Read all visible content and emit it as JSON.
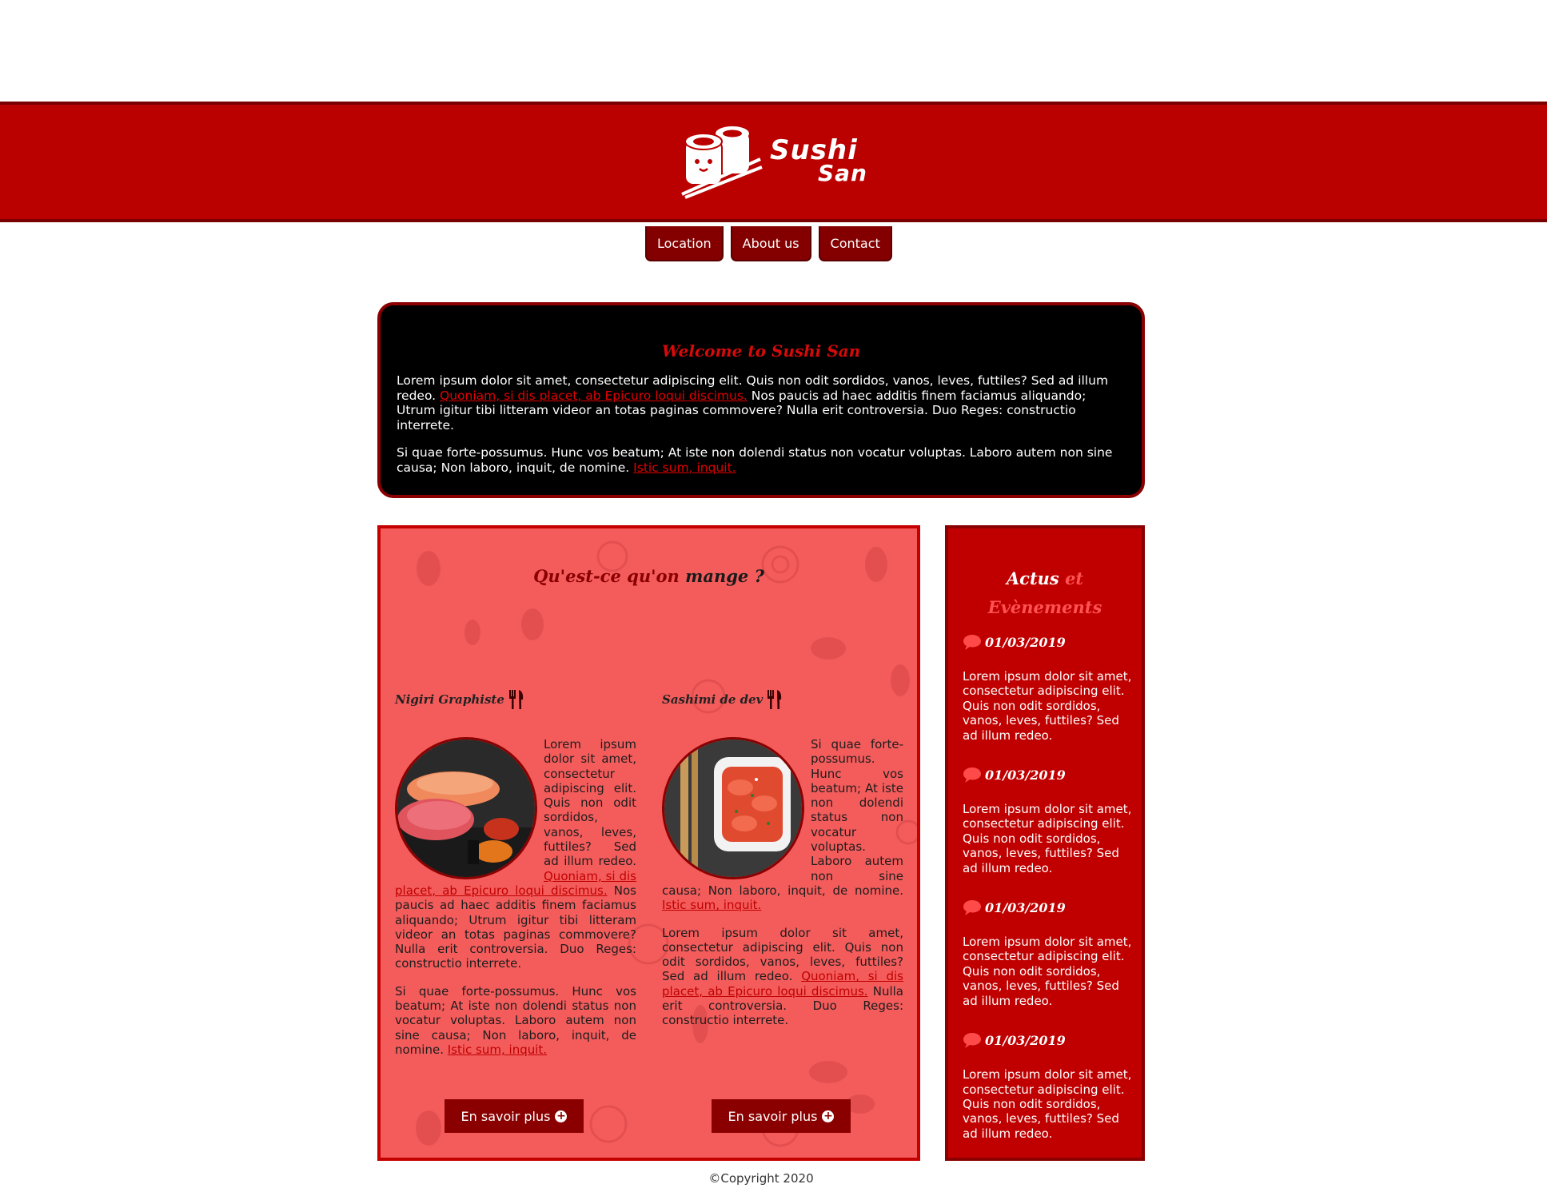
{
  "brand": {
    "line1": "Sushi",
    "line2": "San"
  },
  "nav": {
    "items": [
      "Location",
      "About us",
      "Contact"
    ]
  },
  "welcome": {
    "title": "Welcome to Sushi San",
    "p1_text1": "Lorem ipsum dolor sit amet, consectetur adipiscing elit. Quis non odit sordidos, vanos, leves, futtiles? Sed ad illum redeo.",
    "p1_link": "Quoniam, si dis placet, ab Epicuro loqui discimus.",
    "p1_text2": " Nos paucis ad haec additis finem faciamus aliquando; Utrum igitur tibi litteram videor an totas paginas commovere? Nulla erit controversia. Duo Reges: constructio interrete.",
    "p2_text": "Si quae forte-possumus. Hunc vos beatum; At iste non dolendi status non vocatur voluptas. Laboro autem non sine causa; Non laboro, inquit, de nomine.",
    "p2_link": "Istic sum, inquit."
  },
  "menu": {
    "title_part1": "Qu'est-ce qu'on",
    "title_part2": "mange ?",
    "items": [
      {
        "name": "Nigiri Graphiste",
        "p1_text": "Lorem ipsum dolor sit amet, consectetur adipiscing elit. Quis non odit sordidos, vanos, leves, futtiles? Sed ad illum redeo.",
        "p1_link": "Quoniam, si dis placet, ab Epicuro loqui discimus.",
        "p1_text2": " Nos paucis ad haec additis finem faciamus aliquando; Utrum igitur tibi litteram videor an totas paginas commovere? Nulla erit controversia. Duo Reges: constructio interrete.",
        "p2_text": "Si quae forte-possumus. Hunc vos beatum; At iste non dolendi status non vocatur voluptas. Laboro autem non sine causa; Non laboro, inquit, de nomine.",
        "p2_link": "Istic sum, inquit.",
        "button": "En savoir plus"
      },
      {
        "name": "Sashimi de dev",
        "p1_text": "Si quae forte-possumus. Hunc vos beatum; At iste non dolendi status non vocatur voluptas. Laboro autem non sine causa; Non laboro, inquit, de nomine.",
        "p1_link": "Istic sum, inquit.",
        "p2_text": "Lorem ipsum dolor sit amet, consectetur adipiscing elit. Quis non odit sordidos, vanos, leves, futtiles? Sed ad illum redeo.",
        "p2_link": "Quoniam, si dis placet, ab Epicuro loqui discimus.",
        "p2_text2": " Nulla erit controversia. Duo Reges: constructio interrete.",
        "button": "En savoir plus"
      }
    ]
  },
  "news": {
    "title_part1": "Actus",
    "title_part2": "et",
    "title_part3": "Evènements",
    "items": [
      {
        "date": "01/03/2019",
        "text": "Lorem ipsum dolor sit amet, consectetur adipiscing elit. Quis non odit sordidos, vanos, leves, futtiles? Sed ad illum redeo."
      },
      {
        "date": "01/03/2019",
        "text": "Lorem ipsum dolor sit amet, consectetur adipiscing elit. Quis non odit sordidos, vanos, leves, futtiles? Sed ad illum redeo."
      },
      {
        "date": "01/03/2019",
        "text": "Lorem ipsum dolor sit amet, consectetur adipiscing elit. Quis non odit sordidos, vanos, leves, futtiles? Sed ad illum redeo."
      },
      {
        "date": "01/03/2019",
        "text": "Lorem ipsum dolor sit amet, consectetur adipiscing elit. Quis non odit sordidos, vanos, leves, futtiles? Sed ad illum redeo."
      }
    ]
  },
  "footer": {
    "copyright": "©Copyright 2020"
  },
  "colors": {
    "brand_red": "#bb0000",
    "dark_red": "#8a0000",
    "panel_pink": "#f45c5c"
  },
  "icons": {
    "logo": "sushi-roll-chopsticks-icon",
    "utensils": "fork-knife-icon",
    "comment": "speech-bubble-icon",
    "plus": "plus-circle-icon"
  }
}
